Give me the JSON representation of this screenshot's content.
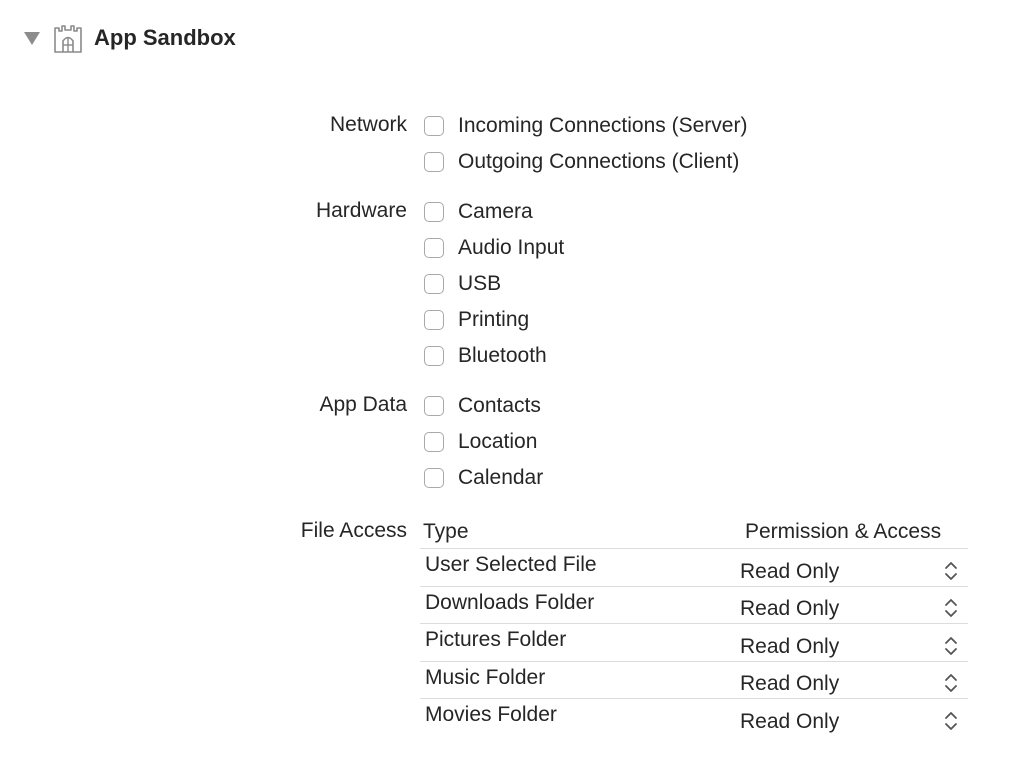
{
  "header": {
    "title": "App Sandbox",
    "disclosure_icon": "triangle-down",
    "sandbox_icon": "castle"
  },
  "network": {
    "label": "Network",
    "items": [
      {
        "label": "Incoming Connections (Server)",
        "checked": false
      },
      {
        "label": "Outgoing Connections (Client)",
        "checked": false
      }
    ]
  },
  "hardware": {
    "label": "Hardware",
    "items": [
      {
        "label": "Camera",
        "checked": false
      },
      {
        "label": "Audio Input",
        "checked": false
      },
      {
        "label": "USB",
        "checked": false
      },
      {
        "label": "Printing",
        "checked": false
      },
      {
        "label": "Bluetooth",
        "checked": false
      }
    ]
  },
  "app_data": {
    "label": "App Data",
    "items": [
      {
        "label": "Contacts",
        "checked": false
      },
      {
        "label": "Location",
        "checked": false
      },
      {
        "label": "Calendar",
        "checked": false
      }
    ]
  },
  "file_access": {
    "label": "File Access",
    "columns": {
      "type": "Type",
      "permission": "Permission & Access"
    },
    "rows": [
      {
        "type": "User Selected File",
        "permission": "Read Only"
      },
      {
        "type": "Downloads Folder",
        "permission": "Read Only"
      },
      {
        "type": "Pictures Folder",
        "permission": "Read Only"
      },
      {
        "type": "Music Folder",
        "permission": "Read Only"
      },
      {
        "type": "Movies Folder",
        "permission": "Read Only"
      }
    ]
  },
  "colors": {
    "text": "#262626",
    "checkbox_border": "#a9a9a9",
    "divider": "#dcdcdc",
    "disclosure": "#8c8c8c"
  }
}
